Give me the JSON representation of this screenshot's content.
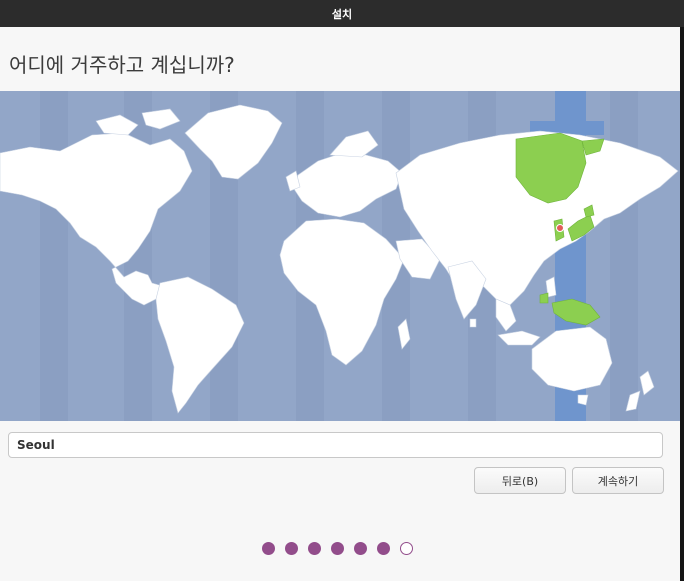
{
  "window": {
    "title": "설치"
  },
  "page": {
    "title": "어디에 거주하고 계십니까?"
  },
  "location": {
    "value": "Seoul"
  },
  "buttons": {
    "back": "뒤로(B)",
    "continue": "계속하기"
  },
  "progress": {
    "total_steps": 7,
    "completed_steps": 6
  },
  "colors": {
    "ocean": "#92a6c8",
    "land": "#ffffff",
    "selected_zone": "#6f95cd",
    "highlight_land": "#8ccf50",
    "marker": "#e25b58",
    "accent": "#924d8b",
    "titlebar": "#2c2c2c"
  }
}
